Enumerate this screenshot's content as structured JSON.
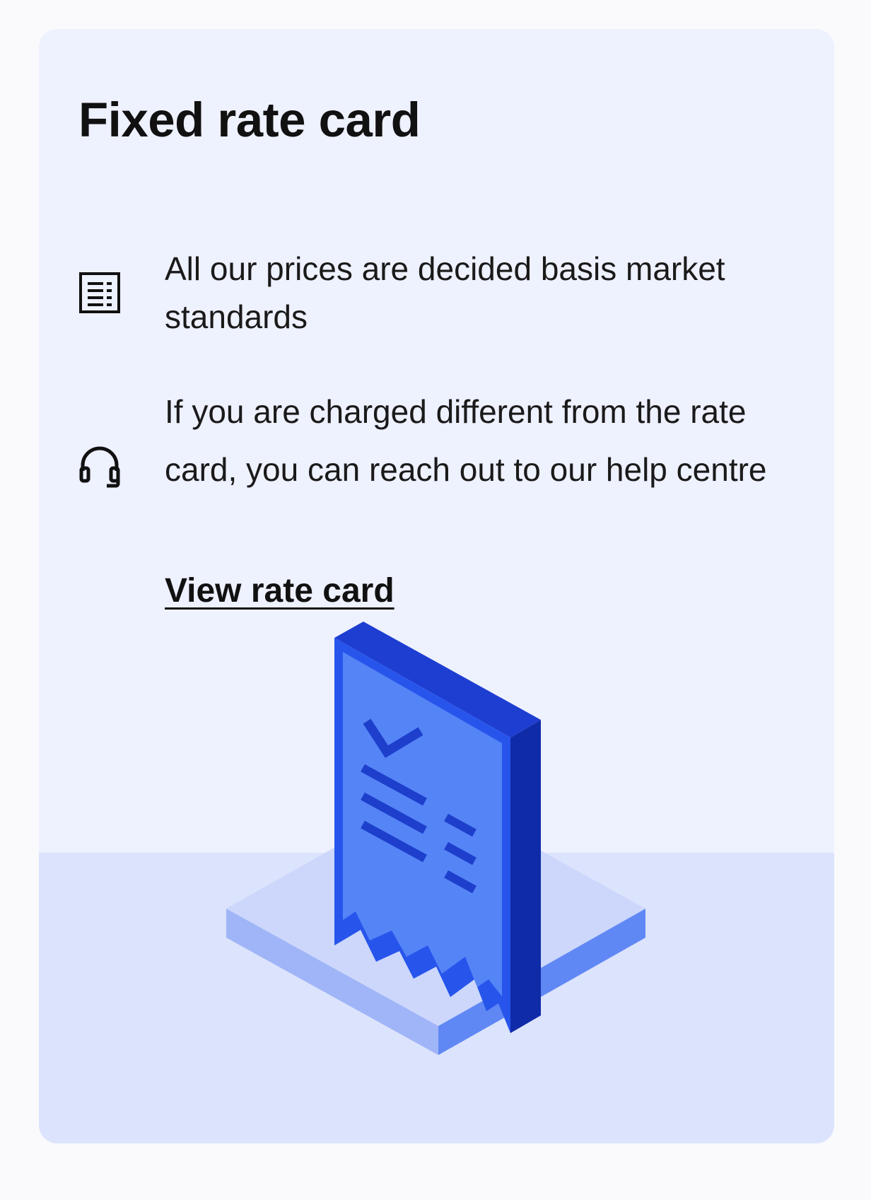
{
  "card": {
    "title": "Fixed rate card",
    "features": [
      {
        "icon": "list-document-icon",
        "text": "All our prices are decided basis market standards"
      },
      {
        "icon": "headset-icon",
        "text": "If you are charged different from the rate card, you can reach out to our help centre"
      }
    ],
    "link_label": "View rate card",
    "illustration": "receipt-illustration"
  },
  "colors": {
    "card_bg": "#EEF1FE",
    "floor_bg": "#DCE3FC",
    "accent_dark": "#1B3FCF",
    "accent_mid": "#2A55EE",
    "accent_light": "#5585F7"
  }
}
